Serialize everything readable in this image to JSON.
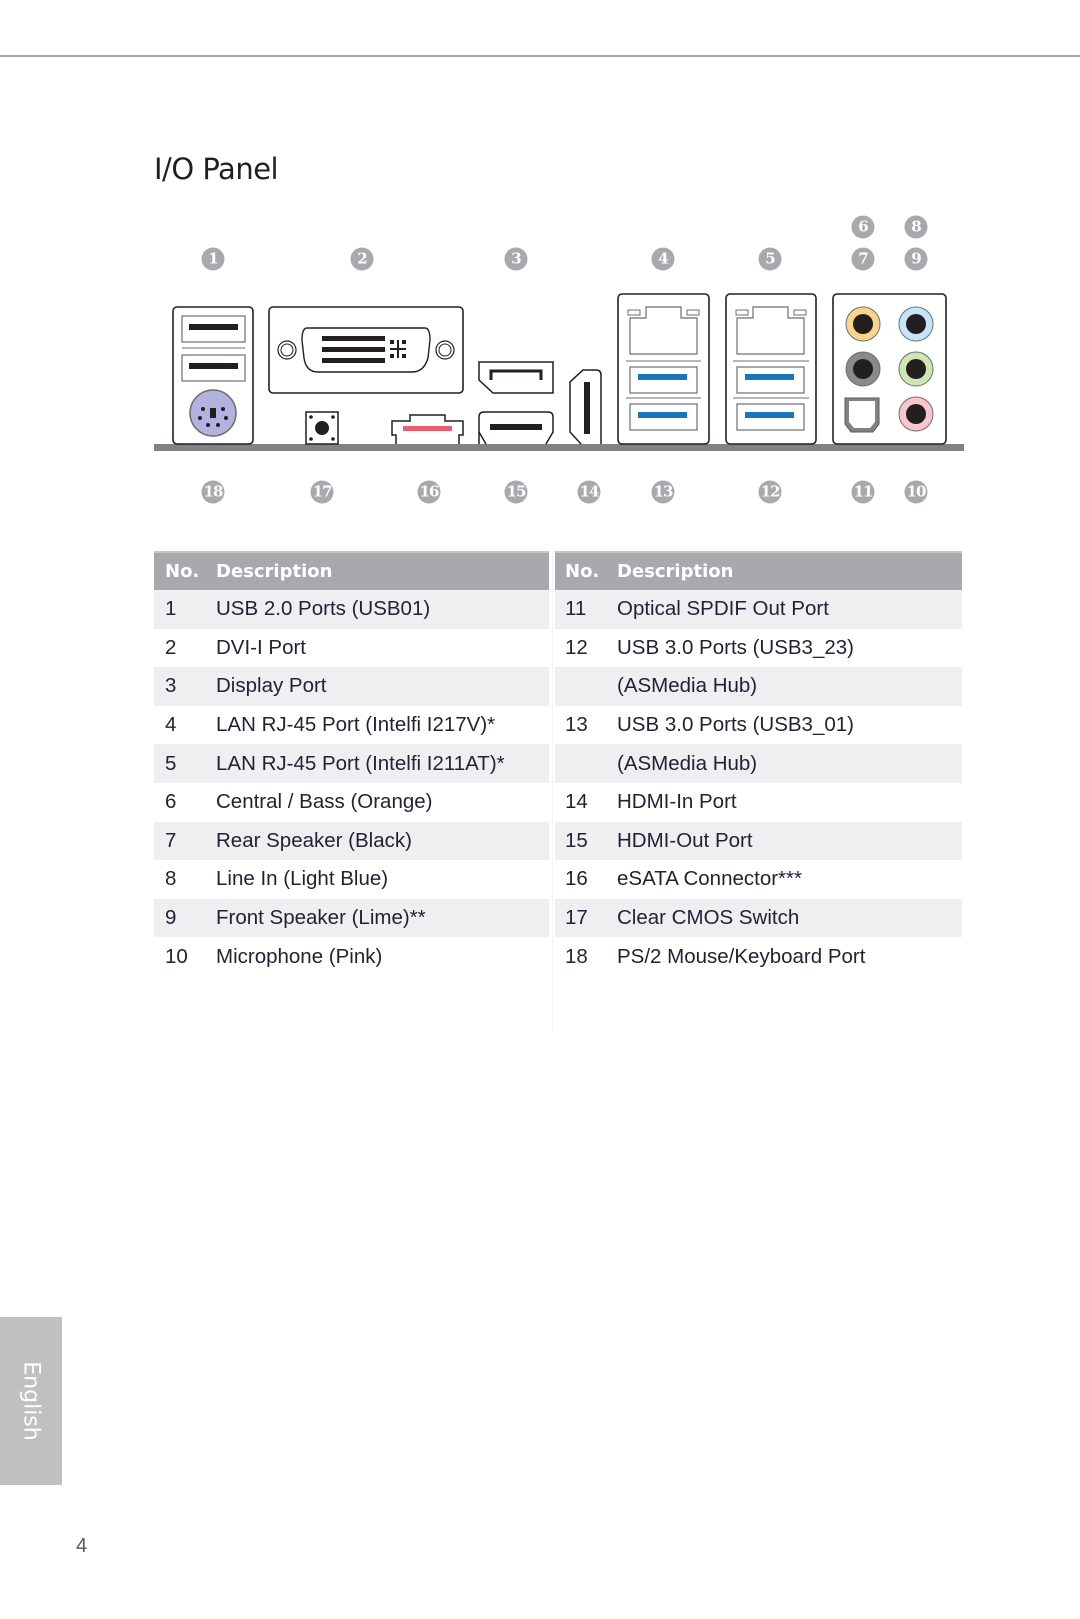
{
  "page": {
    "title": "I/O Panel",
    "page_number": "4",
    "language_tab": "English"
  },
  "callouts": {
    "top": [
      "1",
      "2",
      "3",
      "4",
      "5",
      "6",
      "7",
      "8",
      "9"
    ],
    "bottom": [
      "18",
      "17",
      "16",
      "15",
      "14",
      "13",
      "12",
      "11",
      "10"
    ]
  },
  "colors": {
    "callout_bg": "#a7a9ac",
    "header_bg": "#a7a9ac",
    "row_shade": "#eeeff0",
    "usb3_blue": "#1b75bb",
    "ps2_purple": "#b3b1dd",
    "esata_red": "#ee5b6f",
    "audio_orange": "#fbd38d",
    "audio_black": "#8a8a8a",
    "audio_light_blue": "#c6e6f8",
    "audio_lime": "#cde6b4",
    "audio_pink": "#f9c6cc"
  },
  "table_left": {
    "headers": [
      "No.",
      "Description"
    ],
    "rows": [
      {
        "no": "1",
        "desc": "USB 2.0 Ports (USB01)"
      },
      {
        "no": "2",
        "desc": "DVI-I Port"
      },
      {
        "no": "3",
        "desc": "Display Port"
      },
      {
        "no": "4",
        "desc": "LAN RJ-45 Port (Intelfi I217V)*"
      },
      {
        "no": "5",
        "desc": "LAN RJ-45 Port (Intelfi I211AT)*"
      },
      {
        "no": "6",
        "desc": "Central / Bass (Orange)"
      },
      {
        "no": "7",
        "desc": "Rear Speaker (Black)"
      },
      {
        "no": "8",
        "desc": "Line In (Light Blue)"
      },
      {
        "no": "9",
        "desc": "Front Speaker (Lime)**"
      },
      {
        "no": "10",
        "desc": "Microphone (Pink)"
      }
    ]
  },
  "table_right": {
    "headers": [
      "No.",
      "Description"
    ],
    "rows": [
      {
        "no": "11",
        "desc": "Optical SPDIF Out Port"
      },
      {
        "no": "12",
        "desc": "USB 3.0 Ports (USB3_23)"
      },
      {
        "no": "",
        "desc": "(ASMedia Hub)"
      },
      {
        "no": "13",
        "desc": "USB 3.0 Ports (USB3_01)"
      },
      {
        "no": "",
        "desc": "(ASMedia Hub)"
      },
      {
        "no": "14",
        "desc": "HDMI-In Port"
      },
      {
        "no": "15",
        "desc": "HDMI-Out Port"
      },
      {
        "no": "16",
        "desc": "eSATA Connector***"
      },
      {
        "no": "17",
        "desc": "Clear CMOS Switch"
      },
      {
        "no": "18",
        "desc": "PS/2 Mouse/Keyboard Port"
      }
    ]
  }
}
